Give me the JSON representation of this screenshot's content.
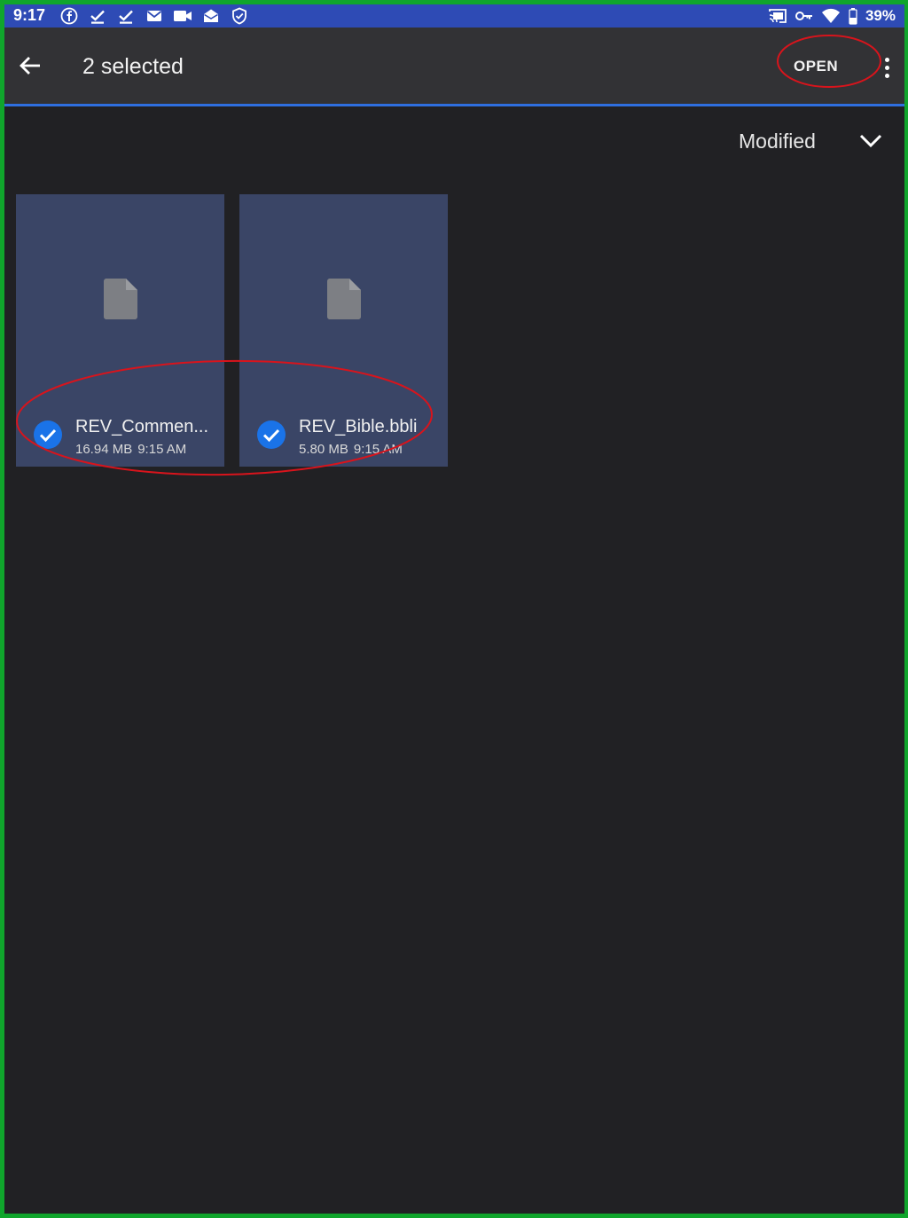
{
  "status_bar": {
    "time": "9:17",
    "battery": "39%",
    "left_icons": [
      "facebook-icon",
      "download-done-icon",
      "download-done-icon",
      "mail-icon",
      "video-icon",
      "mail-open-icon",
      "shield-icon"
    ],
    "right_icons": [
      "cast-icon",
      "vpn-key-icon",
      "wifi-icon",
      "battery-icon"
    ]
  },
  "app_bar": {
    "title": "2 selected",
    "open_label": "OPEN",
    "back_icon": "arrow-back-icon",
    "more_icon": "more-vert-icon"
  },
  "sort": {
    "label": "Modified",
    "icon": "chevron-down-icon"
  },
  "files": [
    {
      "name": "REV_Commen...",
      "size": "16.94 MB",
      "time": "9:15 AM",
      "selected": true,
      "icon": "file-icon"
    },
    {
      "name": "REV_Bible.bbli",
      "size": "5.80 MB",
      "time": "9:15 AM",
      "selected": true,
      "icon": "file-icon"
    }
  ],
  "colors": {
    "status_bar": "#2e4bb5",
    "app_bar": "#323235",
    "background": "#212124",
    "card": "#3a4566",
    "accent": "#2f6fe0",
    "check": "#1a73e8",
    "annotation": "#d8141c",
    "border": "#10a52c"
  }
}
